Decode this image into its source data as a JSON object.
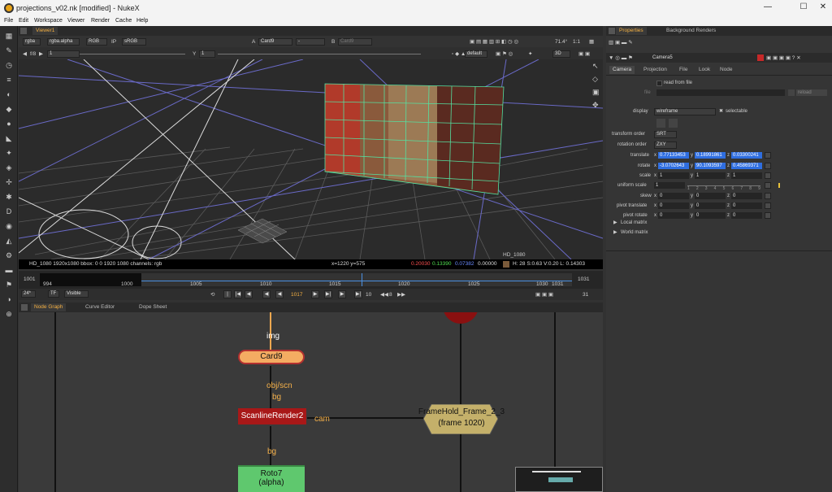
{
  "window": {
    "title": "projections_v02.nk [modified] - NukeX",
    "min": "—",
    "max": "☐",
    "close": "✕"
  },
  "menu": [
    "File",
    "Edit",
    "Workspace",
    "Viewer",
    "Render",
    "Cache",
    "Help"
  ],
  "viewer": {
    "tab": "Viewer1",
    "channels": "rgba",
    "alpha": "rgba.alpha",
    "colorspace_rgb": "RGB",
    "ip": "IP",
    "srgb": "sRGB",
    "a_label": "A",
    "a_input": "Card9",
    "dash": "-",
    "b_label": "B",
    "b_input": "Card9",
    "zoom": "71.4°",
    "ratio": "1:1",
    "fstop": "f/8",
    "frame_field": "1",
    "y_label": "Y",
    "y_field": "1",
    "default": "default",
    "mode3d": "3D",
    "hd_label": "HD_1080",
    "status": {
      "format": "HD_1080 1920x1080 bbox: 0 0 1920 1080 channels: rgb",
      "coords": "x=1220 y=575",
      "r": "0.20030",
      "g": "0.13390",
      "b": "0.07382",
      "a": "0.00000",
      "hsv": "H: 28 S:0.63 V:0.20 L: 0.14303"
    }
  },
  "timeline": {
    "start": "1001",
    "end": "1031",
    "in": "994",
    "out": "1031",
    "ticks": [
      "1000",
      "1005",
      "1010",
      "1015",
      "1020",
      "1025",
      "1030"
    ],
    "current": "1017",
    "fps": "24*",
    "tf": "TF",
    "visible": "Visible",
    "step": "10",
    "inc": "8",
    "frames": "31"
  },
  "bottom_tabs": [
    "Node Graph",
    "Curve Editor",
    "Dope Sheet"
  ],
  "nodes": {
    "card9": "Card9",
    "card_in": "img",
    "scan_in1": "obj/scn",
    "scan_in2": "bg",
    "scanline": "ScanlineRender2",
    "cam": "cam",
    "framehold": "FrameHold_Frame_2_3",
    "framehold_sub": "(frame 1020)",
    "roto_in": "bg",
    "roto": "Roto7",
    "roto_sub": "(alpha)"
  },
  "properties": {
    "tabs": [
      "Properties",
      "Background Renders"
    ],
    "node_name": "Camera5",
    "subtabs": [
      "Camera",
      "Projection",
      "File",
      "Look",
      "Node"
    ],
    "read_from_file": "read from file",
    "file_label": "file",
    "reload": "reload",
    "display_label": "display",
    "display_value": "wireframe",
    "selectable": "selectable",
    "transform_order_label": "transform order",
    "transform_order": "SRT",
    "rotation_order_label": "rotation order",
    "rotation_order": "ZXY",
    "translate_label": "translate",
    "translate": {
      "x": "0.77133453",
      "y": "0.18991861",
      "z": "0.03300241"
    },
    "rotate_label": "rotate",
    "rotate": {
      "x": "-3.0702643",
      "y": "90.1093597",
      "z": "0.45869371"
    },
    "scale_label": "scale",
    "scale": {
      "x": "1",
      "y": "1",
      "z": "1"
    },
    "uniform_label": "uniform scale",
    "uniform": "1",
    "uniform_ticks": [
      "1",
      "2",
      "3",
      "4",
      "5",
      "6",
      "7",
      "8",
      "9"
    ],
    "skew_label": "skew",
    "skew": {
      "x": "0",
      "y": "0",
      "z": "0"
    },
    "pivot_t_label": "pivot translate",
    "pivot_t": {
      "x": "0",
      "y": "0",
      "z": "0"
    },
    "pivot_r_label": "pivot rotate",
    "pivot_r": {
      "x": "0",
      "y": "0",
      "z": "0"
    },
    "local_matrix": "Local matrix",
    "world_matrix": "World matrix",
    "axis_x": "x",
    "axis_y": "y",
    "axis_z": "z"
  }
}
